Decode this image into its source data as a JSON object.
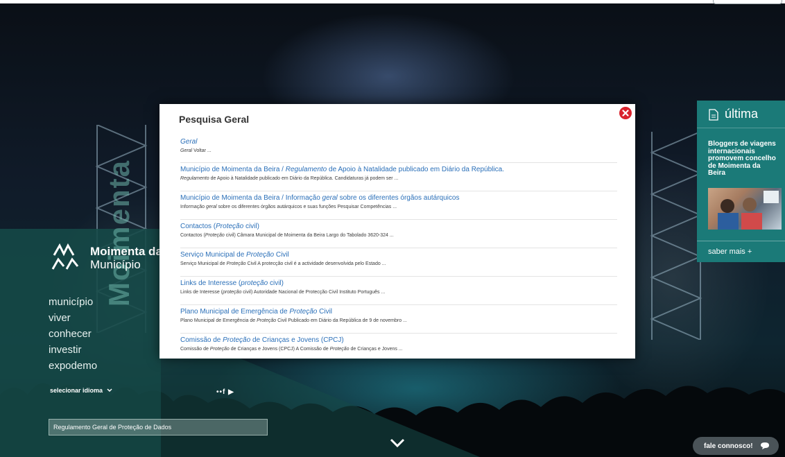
{
  "brand": {
    "name": "Moimenta da",
    "subtitle": "Município",
    "watermark": "Moimenta"
  },
  "nav": {
    "items": [
      "município",
      "viver",
      "conhecer",
      "investir",
      "expodemo"
    ]
  },
  "language": {
    "label": "selecionar idioma"
  },
  "social": {
    "glyphs": "••f ▶"
  },
  "rgpd": {
    "label": "Regulamento Geral de Proteção de Dados"
  },
  "news": {
    "heading": "última",
    "title": "Bloggers de viagens internacionais promovem concelho de Moimenta da Beira",
    "more": "saber mais +"
  },
  "contact": {
    "label": "fale connosco!"
  },
  "modal": {
    "title": "Pesquisa Geral",
    "results": [
      {
        "title": [
          {
            "t": "Geral",
            "em": true
          }
        ],
        "snippet": [
          {
            "t": "Geral",
            "em": true
          },
          {
            "t": " Voltar ..."
          }
        ]
      },
      {
        "title": [
          {
            "t": "Município de Moimenta da Beira / "
          },
          {
            "t": "Regulamento",
            "em": true
          },
          {
            "t": " de Apoio à Natalidade publicado em Diário da República."
          }
        ],
        "snippet": [
          {
            "t": "Regulamento",
            "em": true
          },
          {
            "t": " de Apoio à Natalidade publicado em Diário da República. Candidaturas já podem ser ..."
          }
        ]
      },
      {
        "title": [
          {
            "t": "Município de Moimenta da Beira / Informação "
          },
          {
            "t": "geral",
            "em": true
          },
          {
            "t": " sobre os diferentes órgãos autárquicos"
          }
        ],
        "snippet": [
          {
            "t": "Informação "
          },
          {
            "t": "geral",
            "em": true
          },
          {
            "t": " sobre os diferentes órgãos autárquicos e suas funções Pesquisar Competências ..."
          }
        ]
      },
      {
        "title": [
          {
            "t": "Contactos ("
          },
          {
            "t": "Proteção",
            "em": true
          },
          {
            "t": " civil)"
          }
        ],
        "snippet": [
          {
            "t": "Contactos ("
          },
          {
            "t": "Proteção",
            "em": true
          },
          {
            "t": " civil) Câmara Municipal de Moimenta da Beira Largo do Tabolado 3620-324 ..."
          }
        ]
      },
      {
        "title": [
          {
            "t": "Serviço Municipal de "
          },
          {
            "t": "Proteção",
            "em": true
          },
          {
            "t": " Civil"
          }
        ],
        "snippet": [
          {
            "t": "Serviço Municipal de "
          },
          {
            "t": "Proteção",
            "em": true
          },
          {
            "t": " Civil A protecção civil é a actividade desenvolvida pelo Estado ..."
          }
        ]
      },
      {
        "title": [
          {
            "t": "Links de Interesse ("
          },
          {
            "t": "proteção",
            "em": true
          },
          {
            "t": " civil)"
          }
        ],
        "snippet": [
          {
            "t": "Links de Interesse ("
          },
          {
            "t": "proteção",
            "em": true
          },
          {
            "t": " civil) Autoridade Nacional de Protecção Civil Instituto Português ..."
          }
        ]
      },
      {
        "title": [
          {
            "t": "Plano Municipal de Emergência de "
          },
          {
            "t": "Proteção",
            "em": true
          },
          {
            "t": " Civil"
          }
        ],
        "snippet": [
          {
            "t": "Plano Municipal de Emergência de "
          },
          {
            "t": "Proteção",
            "em": true
          },
          {
            "t": " Civil Publicado em  Diário da República de 9 de novembro ..."
          }
        ]
      },
      {
        "title": [
          {
            "t": "Comissão de "
          },
          {
            "t": "Proteção",
            "em": true
          },
          {
            "t": " de Crianças e Jovens (CPCJ)"
          }
        ],
        "snippet": [
          {
            "t": "Comissão de "
          },
          {
            "t": "Proteção",
            "em": true
          },
          {
            "t": " de Crianças e Jovens (CPCJ)   A Comissão de "
          },
          {
            "t": "Proteção",
            "em": true
          },
          {
            "t": " de Crianças e Jovens ..."
          }
        ]
      }
    ]
  },
  "colors": {
    "teal_panel": "#164a48",
    "news_teal": "#1b7a78",
    "link_blue": "#2a6fb8",
    "close_red": "#d9232e"
  },
  "icons": [
    "municipio-logo-icon",
    "chevron-down-icon",
    "document-icon",
    "close-icon",
    "chat-bubble-icon"
  ]
}
